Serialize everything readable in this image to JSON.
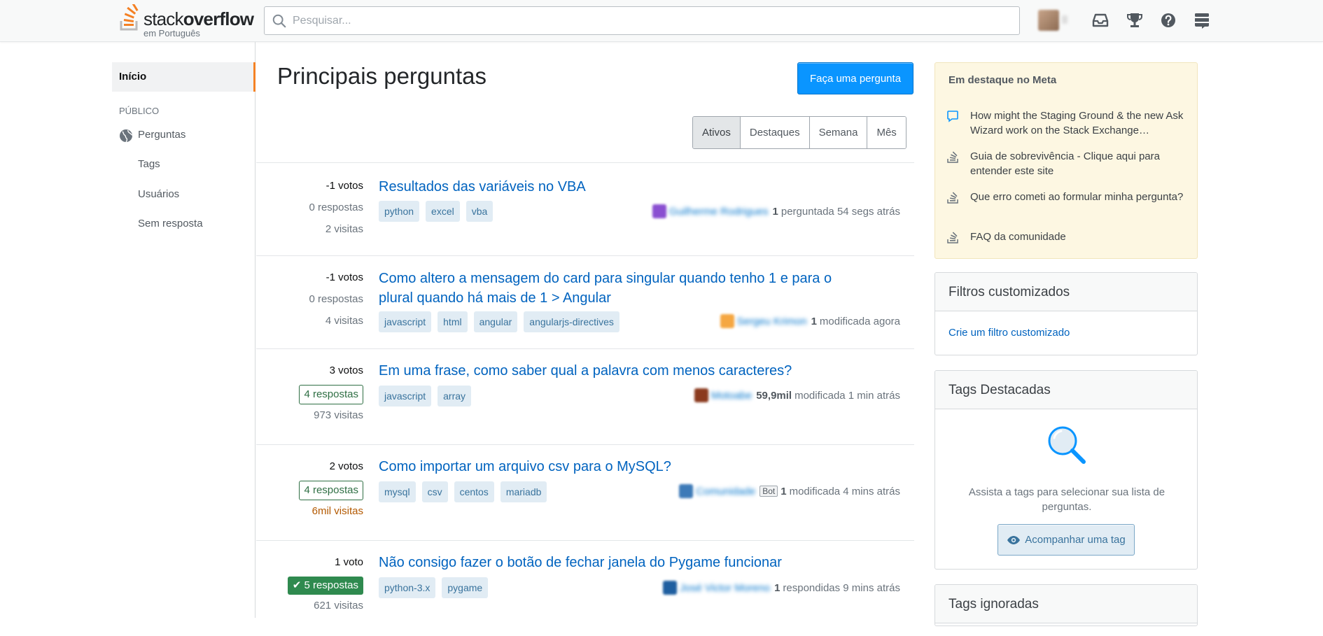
{
  "header": {
    "logo_main_light": "stack",
    "logo_main_bold": "overflow",
    "logo_sub": "em Português",
    "search_placeholder": "Pesquisar..."
  },
  "sidebar": {
    "home": "Início",
    "section": "PÚBLICO",
    "items": [
      "Perguntas",
      "Tags",
      "Usuários",
      "Sem resposta"
    ]
  },
  "main": {
    "title": "Principais perguntas",
    "ask_button": "Faça uma pergunta",
    "filters": [
      "Ativos",
      "Destaques",
      "Semana",
      "Mês"
    ],
    "active_filter": "Ativos",
    "questions": [
      {
        "votes": "-1 votos",
        "answers": "0 respostas",
        "views": "2 visitas",
        "title": "Resultados das variáveis no VBA",
        "tags": [
          "python",
          "excel",
          "vba"
        ],
        "user": "Guilherme Rodrigues",
        "rep": "1",
        "action": "perguntada 54 segs atrás",
        "avatar_color": "#8a4fd1"
      },
      {
        "votes": "-1 votos",
        "answers": "0 respostas",
        "views": "4 visitas",
        "title": "Como altero a mensagem do card para singular quando tenho 1 e para o plural quando há mais de 1 > Angular",
        "tags": [
          "javascript",
          "html",
          "angular",
          "angularjs-directives"
        ],
        "user": "Sergeu Krimon",
        "rep": "1",
        "action": "modificada agora",
        "avatar_color": "#f5a742"
      },
      {
        "votes": "3 votos",
        "answers": "4 respostas",
        "views": "973 visitas",
        "title": "Em uma frase, como saber qual a palavra com menos caracteres?",
        "tags": [
          "javascript",
          "array"
        ],
        "user": "Motoabe",
        "rep": "59,9mil",
        "action": "modificada 1 min atrás",
        "avatar_color": "#8b3a1e"
      },
      {
        "votes": "2 votos",
        "answers": "4 respostas",
        "views": "6mil visitas",
        "title": "Como importar um arquivo csv para o MySQL?",
        "tags": [
          "mysql",
          "csv",
          "centos",
          "mariadb"
        ],
        "user": "Comunidade",
        "bot": "Bot",
        "rep": "1",
        "action": "modificada 4 mins atrás",
        "avatar_color": "#3d7ab8"
      },
      {
        "votes": "1 voto",
        "answers": "5 respostas",
        "views": "621 visitas",
        "title": "Não consigo fazer o botão de fechar janela do Pygame funcionar",
        "tags": [
          "python-3.x",
          "pygame"
        ],
        "user": "José Victor Moreno",
        "rep": "1",
        "action": "respondidas 9 mins atrás",
        "avatar_color": "#1f5fa0"
      }
    ]
  },
  "right": {
    "meta_title": "Em destaque no Meta",
    "meta_items": [
      "How might the Staging Ground & the new Ask Wizard work on the Stack Exchange…",
      "Guia de sobrevivência - Clique aqui para entender este site",
      "Que erro cometi ao formular minha pergunta?",
      "FAQ da comunidade"
    ],
    "custom_filters_title": "Filtros customizados",
    "custom_filters_link": "Crie um filtro customizado",
    "watched_title": "Tags Destacadas",
    "watched_text": "Assista a tags para selecionar sua lista de perguntas.",
    "watch_button": "Acompanhar uma tag",
    "ignored_title": "Tags ignoradas"
  },
  "colors": {
    "accent": "#f48225",
    "primary": "#0a95ff",
    "link": "#0063bf",
    "answered": "#2f6f44",
    "hot_views": "#b35900"
  }
}
